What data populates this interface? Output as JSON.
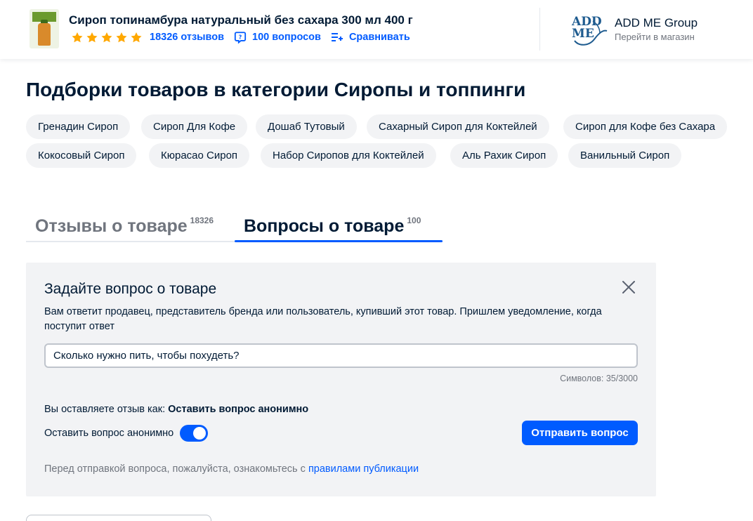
{
  "header": {
    "product_title": "Сироп топинамбура натуральный без сахара 300 мл 400 г",
    "rating_stars": 5,
    "reviews_link": "18326 отзывов",
    "questions_link": "100 вопросов",
    "compare_link": "Сравнивать",
    "seller_name": "ADD ME Group",
    "seller_link": "Перейти в магазин",
    "colors": {
      "accent": "#005bff",
      "star": "#ffa800"
    }
  },
  "collections": {
    "title": "Подборки товаров в категории Сиропы и топпинги",
    "chips": [
      "Гренадин Сироп",
      "Сироп Для Кофе",
      "Дошаб Тутовый",
      "Сахарный Сироп для Коктейлей",
      "Сироп для Кофе без Сахара",
      "Кокосовый Сироп",
      "Кюрасао Сироп",
      "Набор Сиропов для Коктейлей",
      "Аль Рахик Сироп",
      "Ванильный Сироп"
    ]
  },
  "tabs": [
    {
      "label": "Отзывы о товаре",
      "count": "18326",
      "active": false
    },
    {
      "label": "Вопросы о товаре",
      "count": "100",
      "active": true
    }
  ],
  "question_form": {
    "title": "Задайте вопрос о товаре",
    "description": "Вам ответит продавец, представитель бренда или пользователь, купивший этот товар. Пришлем уведомление, когда поступит ответ",
    "input_value": "Сколько нужно пить, чтобы похудеть?",
    "counter": "Символов: 35/3000",
    "as_label": "Вы оставляете отзыв как:",
    "as_value": "Оставить вопрос анонимно",
    "anon_label": "Оставить вопрос анонимно",
    "anon_toggle_on": true,
    "submit_label": "Отправить вопрос",
    "rules_prefix": "Перед отправкой вопроса, пожалуйста, ознакомьтесь с",
    "rules_link": "правилами публикации"
  }
}
